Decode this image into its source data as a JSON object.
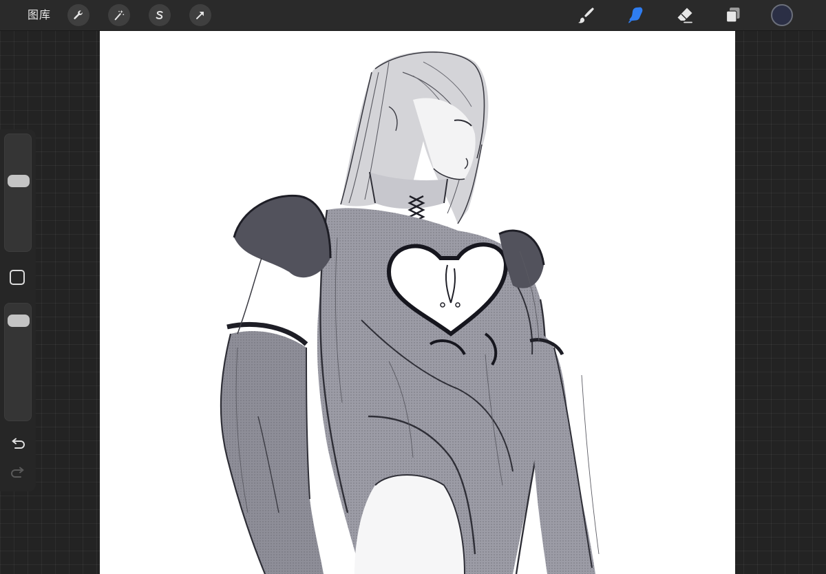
{
  "topbar": {
    "gallery_label": "图库",
    "left_tools": [
      {
        "name": "actions",
        "icon": "wrench-icon"
      },
      {
        "name": "adjustments",
        "icon": "magic-wand-icon"
      },
      {
        "name": "selection",
        "icon": "selection-s-icon"
      },
      {
        "name": "transform",
        "icon": "transform-arrow-icon"
      }
    ],
    "right_tools": [
      {
        "name": "brush",
        "icon": "brush-icon",
        "active": false
      },
      {
        "name": "smudge",
        "icon": "smudge-finger-icon",
        "active": true
      },
      {
        "name": "eraser",
        "icon": "eraser-icon",
        "active": false
      },
      {
        "name": "layers",
        "icon": "layers-icon",
        "active": false
      }
    ],
    "current_color": "#2b2f45",
    "active_tool_color": "#2f7df0"
  },
  "sidebar": {
    "brush_size_level": 0.62,
    "opacity_level": 0.92,
    "modify_icon": "square-icon",
    "undo_icon": "undo-icon",
    "redo_icon": "redo-icon"
  },
  "canvas": {
    "background": "#ffffff",
    "artwork": "sketch-figure-illustration"
  }
}
